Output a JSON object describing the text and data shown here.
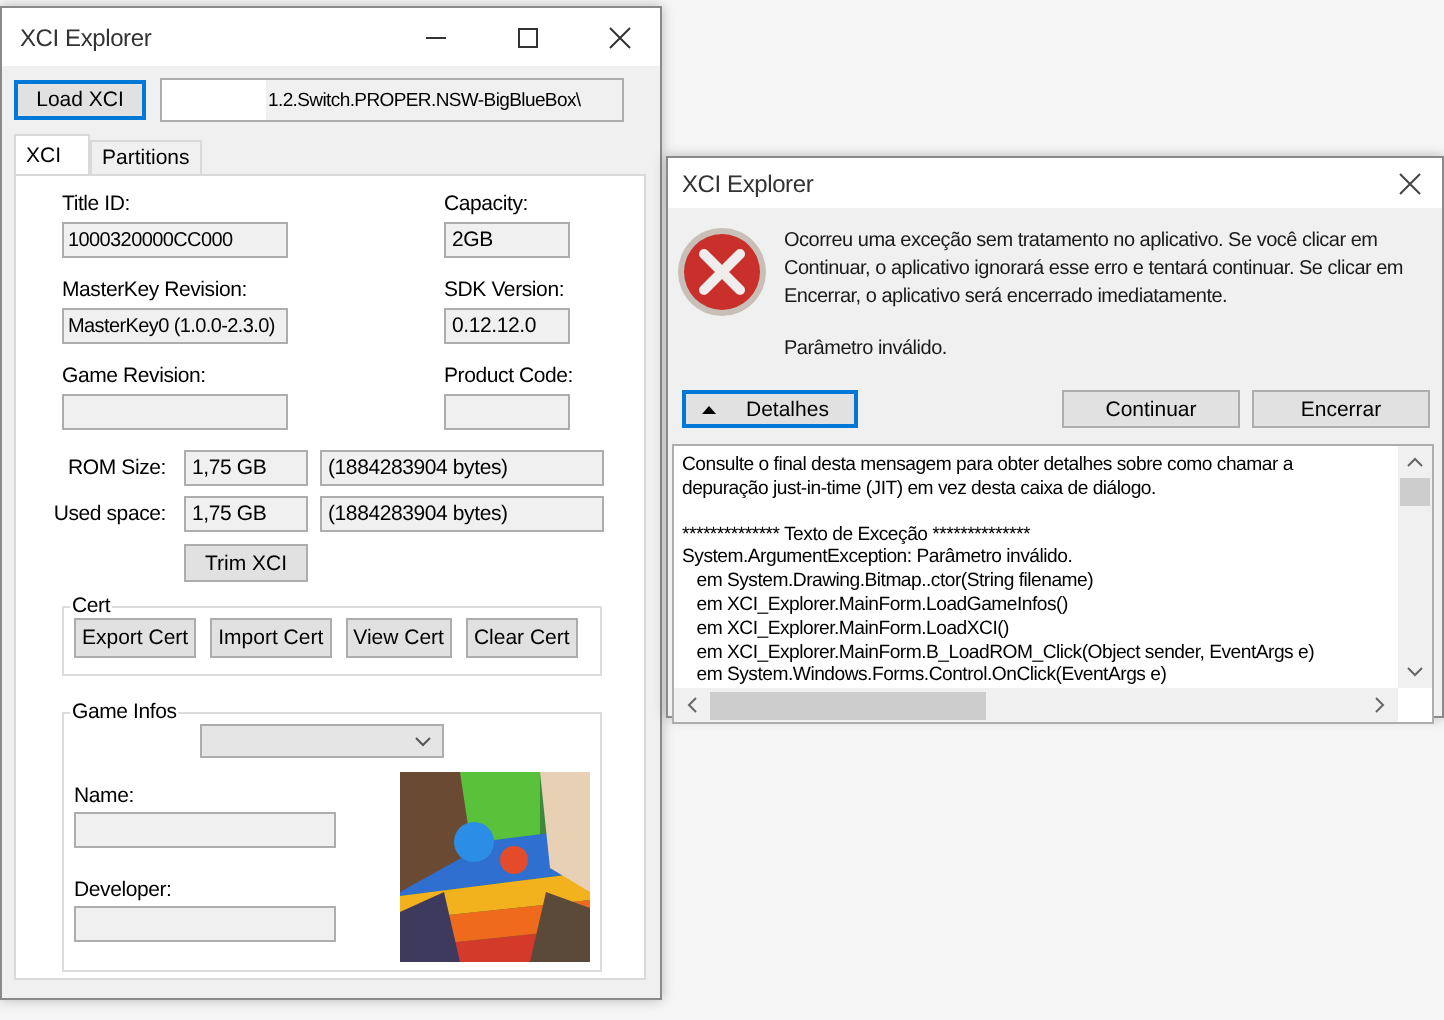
{
  "main_window": {
    "title": "XCI Explorer",
    "load_button": "Load XCI",
    "path_field": {
      "value": "1.2.Switch.PROPER.NSW-BigBlueBox\\"
    },
    "tabs": [
      {
        "label": "XCI",
        "selected": true
      },
      {
        "label": "Partitions",
        "selected": false
      }
    ],
    "info_rows": [
      [
        {
          "label": "Title ID:",
          "value": "1000320000CC000"
        },
        {
          "label": "Capacity:",
          "value": "2GB"
        }
      ],
      [
        {
          "label": "MasterKey Revision:",
          "value": "MasterKey0 (1.0.0-2.3.0)"
        },
        {
          "label": "SDK Version:",
          "value": "0.12.12.0"
        }
      ],
      [
        {
          "label": "Game Revision:"
        },
        {
          "label": "Product Code:"
        }
      ]
    ],
    "size_rows": [
      {
        "label": "ROM Size:",
        "size": "1,75 GB",
        "bytes": "(1884283904 bytes)"
      },
      {
        "label": "Used space:",
        "size": "1,75 GB",
        "bytes": "(1884283904 bytes)"
      }
    ],
    "trim_button": "Trim XCI",
    "cert": {
      "title": "Cert",
      "buttons": [
        "Export Cert",
        "Import Cert",
        "View Cert",
        "Clear Cert"
      ]
    },
    "game_infos": {
      "title": "Game Infos",
      "fields": [
        {
          "label": "Name:"
        },
        {
          "label": "Developer:"
        }
      ]
    }
  },
  "error_dialog": {
    "title": "XCI Explorer",
    "message": "Ocorreu uma exceção sem tratamento no aplicativo. Se você clicar em Continuar, o aplicativo ignorará esse erro e tentará continuar. Se clicar em Encerrar, o aplicativo será encerrado imediatamente.",
    "detail_line": "Parâmetro inválido.",
    "details_button": {
      "label": "Detalhes",
      "expanded": true
    },
    "buttons": [
      "Continuar",
      "Encerrar"
    ],
    "details": [
      {
        "lines": [
          "Consulte o final desta mensagem para obter detalhes sobre como chamar a",
          "depuração just-in-time (JIT) em vez desta caixa de diálogo."
        ]
      },
      {
        "lines": [
          "************** Texto de Exceção **************",
          "System.ArgumentException: Parâmetro inválido.",
          "   em System.Drawing.Bitmap..ctor(String filename)",
          "   em XCI_Explorer.MainForm.LoadGameInfos()",
          "   em XCI_Explorer.MainForm.LoadXCI()",
          "   em XCI_Explorer.MainForm.B_LoadROM_Click(Object sender, EventArgs e)",
          "   em System.Windows.Forms.Control.OnClick(EventArgs e)"
        ]
      }
    ]
  }
}
